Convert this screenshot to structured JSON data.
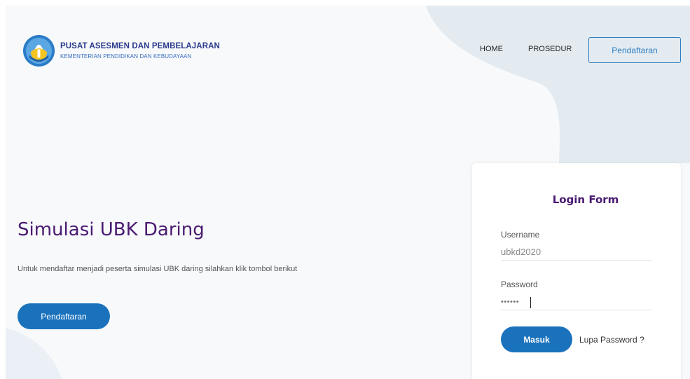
{
  "brand": {
    "title": "PUSAT ASESMEN DAN PEMBELAJARAN",
    "subtitle": "KEMENTERIAN PENDIDIKAN DAN KEBUDAYAAN",
    "logo_icon": "tut-wuri-handayani-logo-icon"
  },
  "nav": {
    "home": "HOME",
    "prosedur": "PROSEDUR",
    "register": "Pendaftaran"
  },
  "hero": {
    "title": "Simulasi UBK Daring",
    "description": "Untuk mendaftar menjadi peserta simulasi UBK daring silahkan klik tombol berikut",
    "button": "Pendaftaran"
  },
  "login": {
    "title": "Login Form",
    "username_label": "Username",
    "username_value": "ubkd2020",
    "password_label": "Password",
    "password_value": "••••••",
    "submit": "Masuk",
    "forgot": "Lupa Password ?"
  },
  "colors": {
    "primary": "#1a72bd",
    "title_purple": "#4a1a72",
    "background": "#f7f9fb",
    "blob": "#e3ebf1"
  }
}
